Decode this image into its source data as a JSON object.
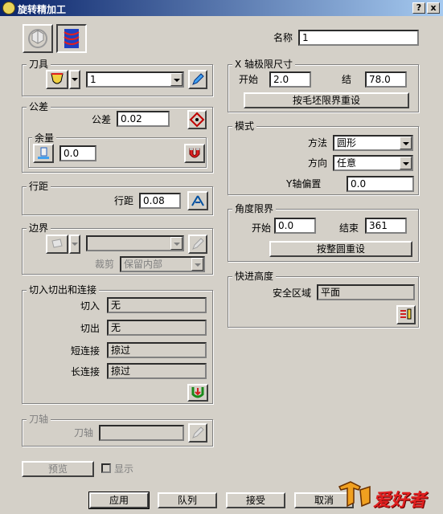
{
  "window": {
    "title": "旋转精加工",
    "help_button": "?",
    "close_button": "x"
  },
  "name": {
    "label": "名称",
    "value": "1"
  },
  "tool": {
    "group": "刀具",
    "combo_value": "1"
  },
  "tolerance": {
    "group": "公差",
    "tol_label": "公差",
    "tol_value": "0.02",
    "stock_group": "余量",
    "stock_value": "0.0"
  },
  "stepover": {
    "group": "行距",
    "label": "行距",
    "value": "0.08"
  },
  "boundary": {
    "group": "边界",
    "combo_value": "",
    "trim_label": "裁剪",
    "trim_value": "保留内部"
  },
  "leads": {
    "group": "切入切出和连接",
    "rows": [
      {
        "label": "切入",
        "value": "无"
      },
      {
        "label": "切出",
        "value": "无"
      },
      {
        "label": "短连接",
        "value": "掠过"
      },
      {
        "label": "长连接",
        "value": "掠过"
      }
    ]
  },
  "tool_axis": {
    "group": "刀轴",
    "label": "刀轴",
    "value": ""
  },
  "preview": {
    "button": "预览",
    "display_label": "显示",
    "display_checked": false
  },
  "x_limits": {
    "group": "X 轴极限尺寸",
    "start_label": "开始",
    "start_value": "2.0",
    "end_label": "结",
    "end_value": "78.0",
    "reset_button": "按毛坯限界重设"
  },
  "pattern": {
    "group": "模式",
    "method_label": "方法",
    "method_value": "圆形",
    "direction_label": "方向",
    "direction_value": "任意",
    "yoffset_label": "Y轴偏置",
    "yoffset_value": "0.0"
  },
  "angle_limits": {
    "group": "角度限界",
    "start_label": "开始",
    "start_value": "0.0",
    "end_label": "结束",
    "end_value": "361",
    "reset_button": "按整圆重设"
  },
  "rapid": {
    "group": "快进高度",
    "safe_label": "安全区域",
    "safe_value": "平面"
  },
  "buttons": {
    "apply": "应用",
    "queue": "队列",
    "accept": "接受",
    "cancel": "取消"
  },
  "watermark": "爱好者",
  "colors": {
    "title_start": "#0a246a",
    "title_end": "#a6caf0",
    "face": "#d4d0c8",
    "shadow": "#808080"
  }
}
